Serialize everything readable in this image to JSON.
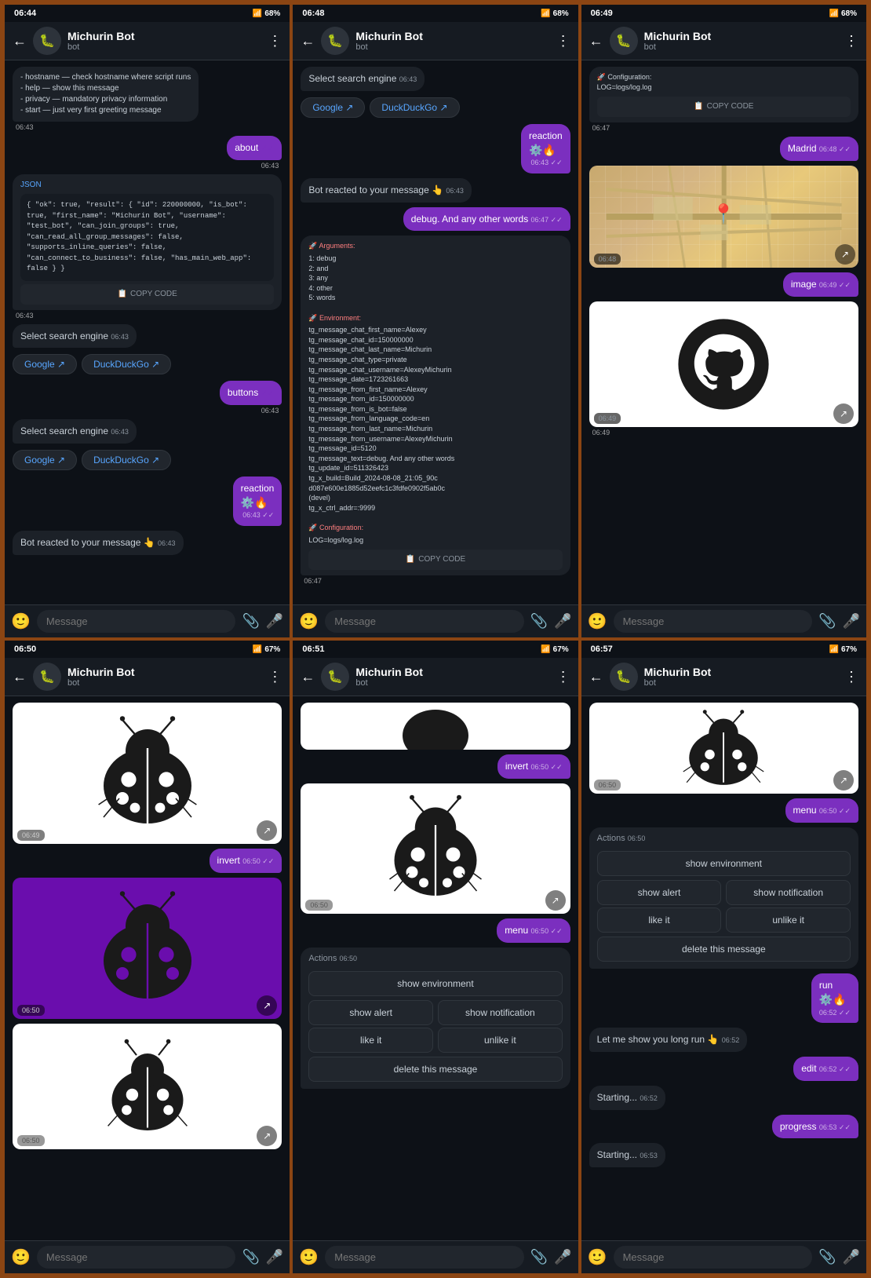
{
  "phones": [
    {
      "id": "phone1",
      "status": {
        "time": "06:44",
        "battery": "68%"
      },
      "header": {
        "name": "Michurin Bot",
        "sub": "bot"
      },
      "messages": [
        {
          "type": "recv-text",
          "text": "- hostname — check hostname where script runs\n- help — show this message\n- privacy — mandatory privacy information\n- start — just very first greeting message",
          "time": "06:43"
        },
        {
          "type": "sent",
          "text": "about",
          "time": "06:43"
        },
        {
          "type": "recv-code",
          "lang": "JSON",
          "code": "{\n  \"ok\": true,\n  \"result\": {\n    \"id\": 220000000,\n    \"is_bot\": true,\n    \"first_name\": \"Michurin Bot\",\n    \"username\": \"test_bot\",\n    \"can_join_groups\": true,\n    \"can_read_all_group_messages\": false,\n    \"supports_inline_queries\": false,\n    \"can_connect_to_business\": false,\n    \"has_main_web_app\": false\n  }\n}",
          "time": "06:43"
        },
        {
          "type": "recv-text",
          "text": "Select search engine",
          "time": "06:43"
        },
        {
          "type": "buttons",
          "buttons": [
            "Google ↗",
            "DuckDuckGo ↗"
          ]
        },
        {
          "type": "sent",
          "text": "buttons",
          "time": "06:43"
        },
        {
          "type": "recv-text",
          "text": "Select search engine",
          "time": "06:43"
        },
        {
          "type": "buttons",
          "buttons": [
            "Google ↗",
            "DuckDuckGo ↗"
          ]
        },
        {
          "type": "sent-reaction",
          "text": "reaction",
          "icons": "⚙️🔥",
          "time": "06:43"
        },
        {
          "type": "recv-text",
          "text": "Bot reacted to your message 👆",
          "time": "06:43"
        }
      ]
    },
    {
      "id": "phone2",
      "status": {
        "time": "06:48",
        "battery": "68%"
      },
      "header": {
        "name": "Michurin Bot",
        "sub": "bot"
      },
      "messages": [
        {
          "type": "recv-text",
          "text": "Select search engine",
          "time": "06:43"
        },
        {
          "type": "buttons",
          "buttons": [
            "Google ↗",
            "DuckDuckGo ↗"
          ]
        },
        {
          "type": "sent-reaction",
          "text": "reaction",
          "icons": "⚙️🔥",
          "time": "06:43"
        },
        {
          "type": "recv-text",
          "text": "Bot reacted to your message 👆",
          "time": "06:43"
        },
        {
          "type": "sent",
          "text": "debug. And any other words",
          "time": "06:47"
        },
        {
          "type": "recv-code-long",
          "time": "06:47"
        }
      ]
    },
    {
      "id": "phone3",
      "status": {
        "time": "06:49",
        "battery": "68%"
      },
      "header": {
        "name": "Michurin Bot",
        "sub": "bot"
      },
      "messages": [
        {
          "type": "recv-config",
          "text": "🚀 Configuration:\nLOG=logs/log.log",
          "time": "06:47"
        },
        {
          "type": "sent",
          "text": "Madrid",
          "time": "06:48"
        },
        {
          "type": "recv-map",
          "time": "06:48"
        },
        {
          "type": "sent",
          "text": "image",
          "time": "06:49"
        },
        {
          "type": "recv-github",
          "time": "06:49"
        }
      ]
    },
    {
      "id": "phone4",
      "status": {
        "time": "06:50",
        "battery": "67%"
      },
      "header": {
        "name": "Michurin Bot",
        "sub": "bot"
      },
      "messages": [
        {
          "type": "recv-ladybug-white",
          "time": "06:49"
        },
        {
          "type": "recv-label-sent",
          "label": "invert",
          "sent_time": "06:50"
        },
        {
          "type": "recv-ladybug-black-inv",
          "time": "06:50"
        },
        {
          "type": "recv-ladybug-black2",
          "time": "06:50"
        }
      ]
    },
    {
      "id": "phone5",
      "status": {
        "time": "06:51",
        "battery": "67%"
      },
      "header": {
        "name": "Michurin Bot",
        "sub": "bot"
      },
      "messages": [
        {
          "type": "recv-ladybug-partial",
          "time": "06:50"
        },
        {
          "type": "sent",
          "text": "invert",
          "time": "06:50"
        },
        {
          "type": "recv-ladybug-white-small",
          "time": "06:50"
        },
        {
          "type": "sent",
          "text": "menu",
          "time": "06:50"
        },
        {
          "type": "recv-text",
          "text": "Actions",
          "time": "06:50"
        },
        {
          "type": "actions-menu"
        }
      ]
    },
    {
      "id": "phone6",
      "status": {
        "time": "06:57",
        "battery": "67%"
      },
      "header": {
        "name": "Michurin Bot",
        "sub": "bot"
      },
      "messages": [
        {
          "type": "recv-ladybug-partial2",
          "time": "06:50"
        },
        {
          "type": "sent",
          "text": "menu",
          "time": "06:50"
        },
        {
          "type": "recv-text",
          "text": "Actions",
          "time": "06:50"
        },
        {
          "type": "actions-menu2"
        },
        {
          "type": "sent-reaction",
          "text": "run",
          "icons": "⚙️🔥",
          "time": "06:52"
        },
        {
          "type": "recv-text",
          "text": "Let me show you long run 👆",
          "time": "06:52"
        },
        {
          "type": "sent",
          "text": "edit",
          "time": "06:52"
        },
        {
          "type": "recv-text",
          "text": "Starting...",
          "time": "06:52"
        },
        {
          "type": "sent",
          "text": "progress",
          "time": "06:53"
        },
        {
          "type": "recv-text",
          "text": "Starting...",
          "time": "06:53"
        }
      ]
    }
  ],
  "labels": {
    "message_placeholder": "Message",
    "bot": "bot",
    "copy_code": "COPY CODE",
    "actions": "Actions",
    "show_environment": "show environment",
    "show_alert": "show alert",
    "show_notification": "show notification",
    "like_it": "like it",
    "unlike_it": "unlike it",
    "delete_this_message": "delete this message"
  }
}
